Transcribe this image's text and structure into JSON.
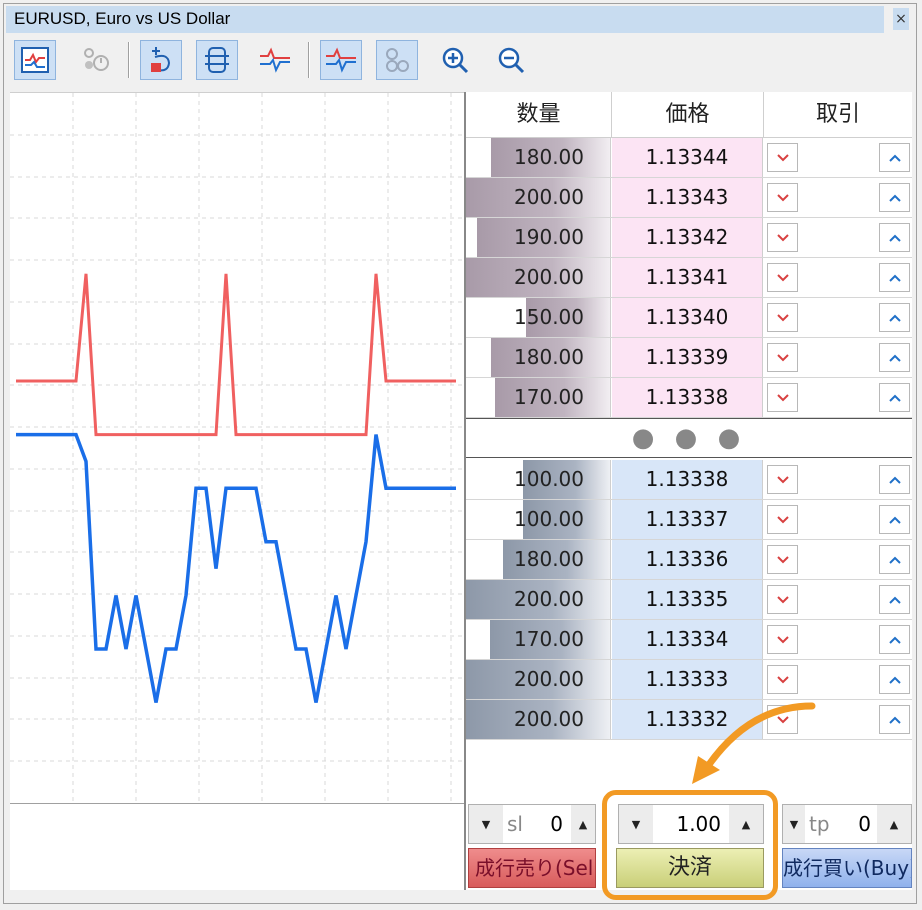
{
  "window": {
    "title": "EURUSD, Euro vs US Dollar",
    "close_glyph": "×"
  },
  "toolbar": {
    "buttons": [
      {
        "name": "chart-icon",
        "active": true
      },
      {
        "name": "auto-trading-icon",
        "active": false
      },
      {
        "name": "one-click-trading-icon",
        "active": true
      },
      {
        "name": "depth-of-market-icon",
        "active": true
      },
      {
        "name": "ticks-chart-icon",
        "active": false
      },
      {
        "name": "tick-line-icon",
        "active": true
      },
      {
        "name": "bubbles-icon",
        "active": true
      },
      {
        "name": "zoom-in-icon",
        "active": false
      },
      {
        "name": "zoom-out-icon",
        "active": false
      }
    ]
  },
  "colors": {
    "ask_line": "#f06060",
    "bid_line": "#1a6ee8",
    "accent": "#f29a24"
  },
  "book": {
    "headers": {
      "volume": "数量",
      "price": "価格",
      "trade": "取引"
    },
    "ellipsis": "● ● ●",
    "asks": [
      {
        "volume": "180.00",
        "price": "1.13344",
        "fill": 0.82
      },
      {
        "volume": "200.00",
        "price": "1.13343",
        "fill": 1.0
      },
      {
        "volume": "190.00",
        "price": "1.13342",
        "fill": 0.92
      },
      {
        "volume": "200.00",
        "price": "1.13341",
        "fill": 1.0
      },
      {
        "volume": "150.00",
        "price": "1.13340",
        "fill": 0.58
      },
      {
        "volume": "180.00",
        "price": "1.13339",
        "fill": 0.82
      },
      {
        "volume": "170.00",
        "price": "1.13338",
        "fill": 0.79
      }
    ],
    "bids": [
      {
        "volume": "100.00",
        "price": "1.13338",
        "fill": 0.6
      },
      {
        "volume": "100.00",
        "price": "1.13337",
        "fill": 0.6
      },
      {
        "volume": "180.00",
        "price": "1.13336",
        "fill": 0.74
      },
      {
        "volume": "200.00",
        "price": "1.13335",
        "fill": 1.0
      },
      {
        "volume": "170.00",
        "price": "1.13334",
        "fill": 0.83
      },
      {
        "volume": "200.00",
        "price": "1.13333",
        "fill": 1.0
      },
      {
        "volume": "200.00",
        "price": "1.13332",
        "fill": 1.0
      }
    ]
  },
  "controls": {
    "sl_label": "sl",
    "sl_value": "0",
    "volume_value": "1.00",
    "tp_label": "tp",
    "tp_value": "0",
    "sell_label": "成行売り(Sell)",
    "close_label": "決済",
    "buy_label": "成行買い(Buy)"
  },
  "chart_data": {
    "type": "line",
    "series": [
      {
        "values": [
          1.1334,
          1.1334,
          1.1334,
          1.1334,
          1.1334,
          1.1334,
          1.1334,
          1.13344,
          1.13338,
          1.13338,
          1.13338,
          1.13338,
          1.13338,
          1.13338,
          1.13338,
          1.13338,
          1.13338,
          1.13338,
          1.13338,
          1.13338,
          1.13338,
          1.13344,
          1.13338,
          1.13338,
          1.13338,
          1.13338,
          1.13338,
          1.13338,
          1.13338,
          1.13338,
          1.13338,
          1.13338,
          1.13338,
          1.13338,
          1.13338,
          1.13338,
          1.13344,
          1.1334,
          1.1334,
          1.1334,
          1.1334,
          1.1334,
          1.1334,
          1.1334,
          1.1334
        ]
      },
      {
        "values": [
          1.13338,
          1.13338,
          1.13338,
          1.13338,
          1.13338,
          1.13338,
          1.13338,
          1.13337,
          1.1333,
          1.1333,
          1.13332,
          1.1333,
          1.13332,
          1.1333,
          1.13328,
          1.1333,
          1.1333,
          1.13332,
          1.13336,
          1.13336,
          1.13333,
          1.13336,
          1.13336,
          1.13336,
          1.13336,
          1.13334,
          1.13334,
          1.13332,
          1.1333,
          1.1333,
          1.13328,
          1.1333,
          1.13332,
          1.1333,
          1.13332,
          1.13334,
          1.13338,
          1.13336,
          1.13336,
          1.13336,
          1.13336,
          1.13336,
          1.13336,
          1.13336,
          1.13336
        ]
      }
    ],
    "ylim": [
      1.13325,
      1.1335
    ],
    "grid": true
  }
}
